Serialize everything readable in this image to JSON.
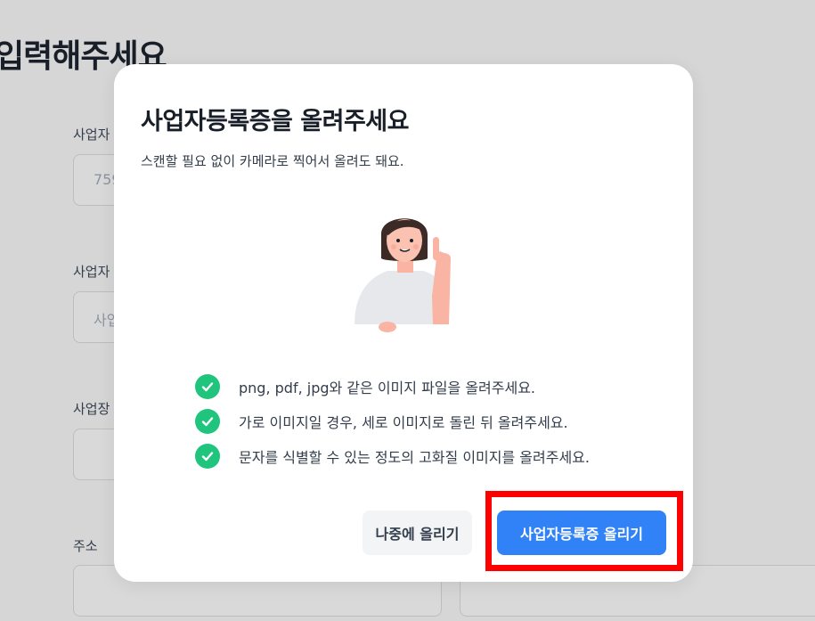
{
  "background": {
    "page_title": "입력해주세요",
    "fields": [
      {
        "label": "사업자",
        "placeholder": "759"
      },
      {
        "label": "사업자",
        "placeholder": "사업"
      },
      {
        "label": "사업장",
        "placeholder": ""
      },
      {
        "label": "주소",
        "placeholder": ""
      }
    ]
  },
  "modal": {
    "title": "사업자등록증을 올려주세요",
    "subtitle": "스캔할 필요 없이 카메라로 찍어서 올려도 돼요.",
    "checklist": [
      "png, pdf, jpg와 같은 이미지 파일을 올려주세요.",
      "가로 이미지일 경우, 세로 이미지로 돌린 뒤 올려주세요.",
      "문자를 식별할 수 있는 정도의 고화질 이미지를 올려주세요."
    ],
    "buttons": {
      "later_label": "나중에 올리기",
      "upload_label": "사업자등록증 올리기"
    }
  },
  "colors": {
    "primary": "#3182f6",
    "check": "#1fc47d",
    "highlight": "#ff0000"
  },
  "icons": [
    "check-circle-icon",
    "person-pointing-illustration"
  ]
}
